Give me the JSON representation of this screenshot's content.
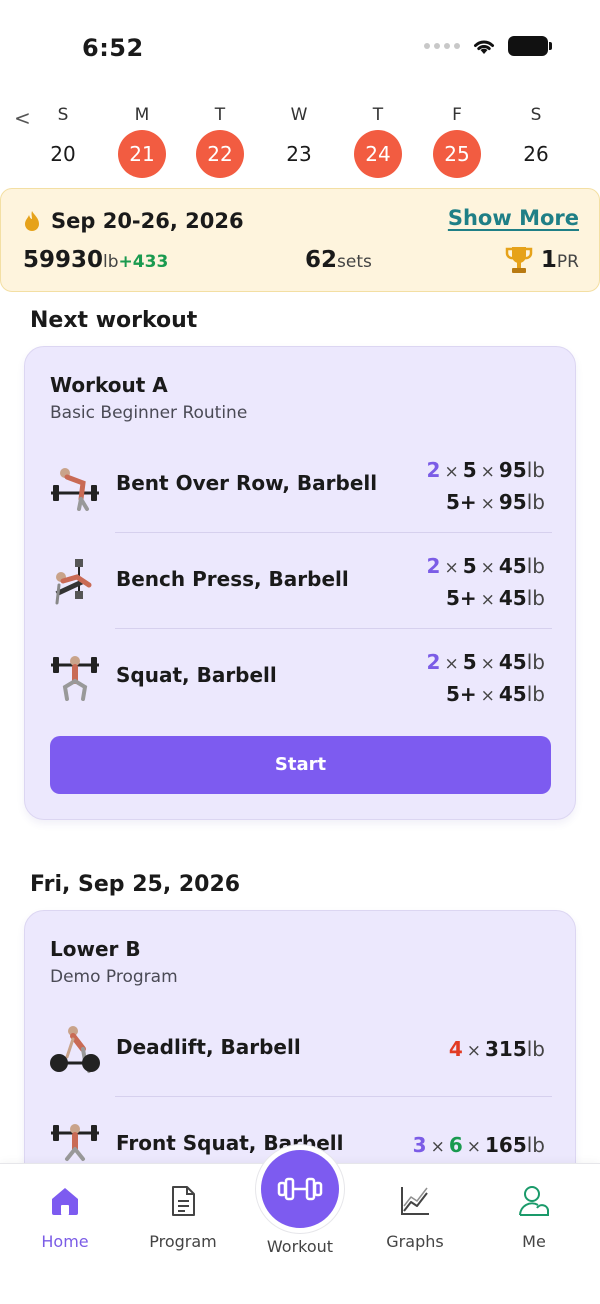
{
  "status_bar": {
    "time": "6:52"
  },
  "week": {
    "prev_label": "<",
    "days": [
      {
        "letter": "S",
        "num": "20",
        "active": false
      },
      {
        "letter": "M",
        "num": "21",
        "active": true
      },
      {
        "letter": "T",
        "num": "22",
        "active": true
      },
      {
        "letter": "W",
        "num": "23",
        "active": false
      },
      {
        "letter": "T",
        "num": "24",
        "active": true
      },
      {
        "letter": "F",
        "num": "25",
        "active": true
      },
      {
        "letter": "S",
        "num": "26",
        "active": false
      }
    ]
  },
  "summary": {
    "range": "Sep 20-26, 2026",
    "show_more": "Show More",
    "volume": "59930",
    "volume_unit": "lb",
    "volume_delta": "+433",
    "sets": "62",
    "sets_unit": "sets",
    "prs": "1",
    "prs_unit": "PR"
  },
  "next_workout": {
    "heading": "Next workout",
    "title": "Workout A",
    "subtitle": "Basic Beginner Routine",
    "exercises": [
      {
        "name": "Bent Over Row, Barbell",
        "line1": {
          "sets": "2",
          "reps": "5",
          "weight": "95",
          "unit": "lb"
        },
        "line2": {
          "reps": "5+",
          "weight": "95",
          "unit": "lb"
        }
      },
      {
        "name": "Bench Press, Barbell",
        "line1": {
          "sets": "2",
          "reps": "5",
          "weight": "45",
          "unit": "lb"
        },
        "line2": {
          "reps": "5+",
          "weight": "45",
          "unit": "lb"
        }
      },
      {
        "name": "Squat, Barbell",
        "line1": {
          "sets": "2",
          "reps": "5",
          "weight": "45",
          "unit": "lb"
        },
        "line2": {
          "reps": "5+",
          "weight": "45",
          "unit": "lb"
        }
      }
    ],
    "start_label": "Start",
    "times": "×"
  },
  "history": {
    "heading": "Fri, Sep 25, 2026",
    "title": "Lower B",
    "subtitle": "Demo Program",
    "exercises": [
      {
        "name": "Deadlift, Barbell",
        "sets": "4",
        "weight": "315",
        "unit": "lb"
      },
      {
        "name": "Front Squat, Barbell",
        "sets": "3",
        "reps": "6",
        "weight": "165",
        "unit": "lb"
      }
    ]
  },
  "nav": {
    "items": [
      {
        "label": "Home",
        "icon": "home-icon",
        "active": true
      },
      {
        "label": "Program",
        "icon": "document-icon",
        "active": false
      },
      {
        "label": "Workout",
        "icon": "dumbbell-icon",
        "active": false
      },
      {
        "label": "Graphs",
        "icon": "line-chart-icon",
        "active": false
      },
      {
        "label": "Me",
        "icon": "profile-icon",
        "active": false
      }
    ]
  },
  "colors": {
    "accent": "#7d5bf0",
    "active_day": "#f25c41",
    "card_bg": "#ece8fd",
    "banner_bg": "#fef4dd",
    "link": "#1f7f86",
    "positive": "#1a9a4f",
    "negative": "#e23b24"
  }
}
